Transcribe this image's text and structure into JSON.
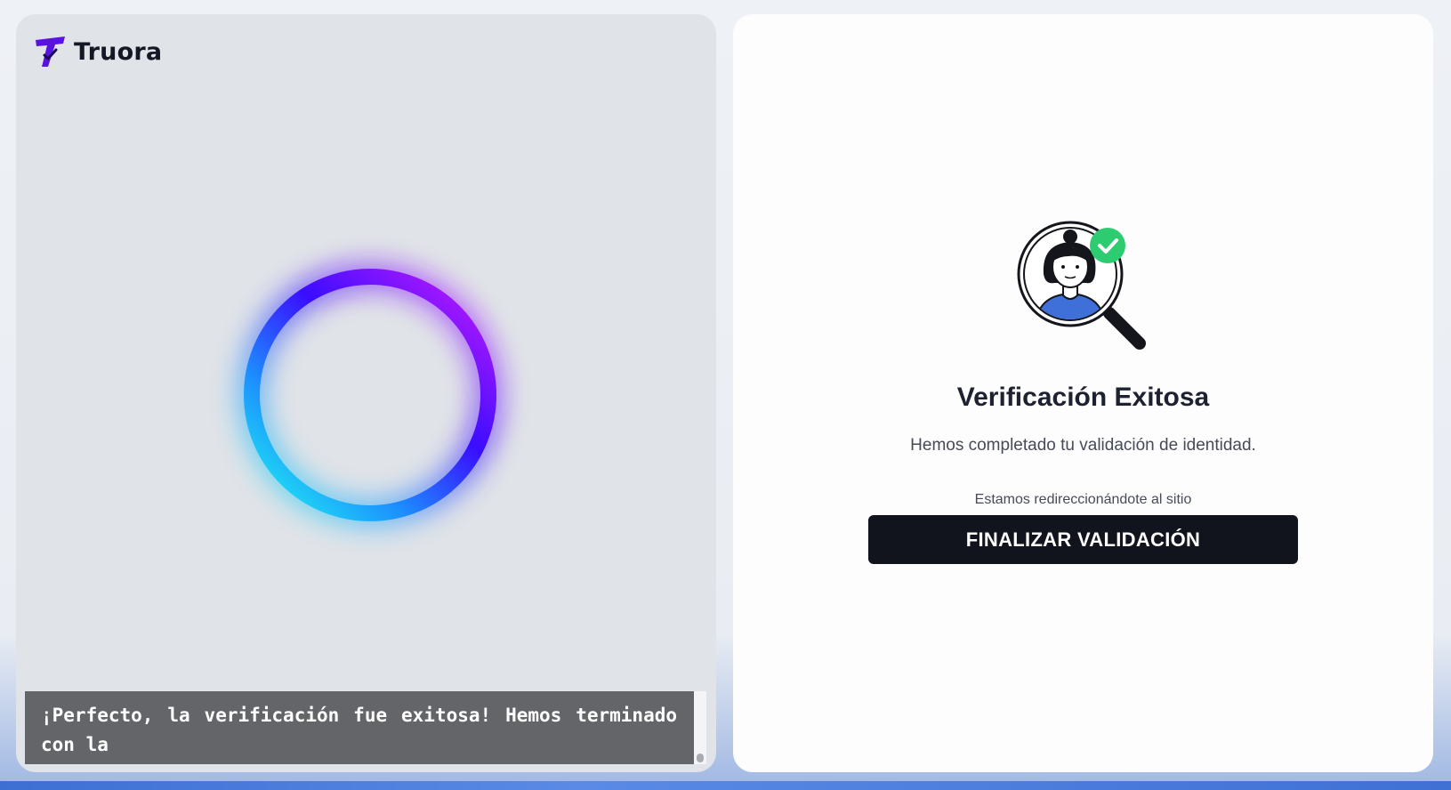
{
  "brand": {
    "name": "Truora",
    "logo_icon": "truora-logo-icon",
    "logo_color": "#5a12e0"
  },
  "left": {
    "indicator_icon": "gradient-ring-indicator",
    "ring_colors": [
      "#1ef1f0",
      "#2a5cff",
      "#3a0dff",
      "#c01aff"
    ],
    "caption": {
      "text": "¡Perfecto, la verificación fue exitosa! Hemos terminado con la"
    }
  },
  "result": {
    "illustration_icon": "verified-person-magnifier-icon",
    "check_color": "#2ecc71",
    "title": "Verificación Exitosa",
    "subtitle": "Hemos completado tu validación de identidad.",
    "redirect_text": "Estamos redireccionándote al sitio",
    "finish_label": "FINALIZAR VALIDACIÓN"
  }
}
